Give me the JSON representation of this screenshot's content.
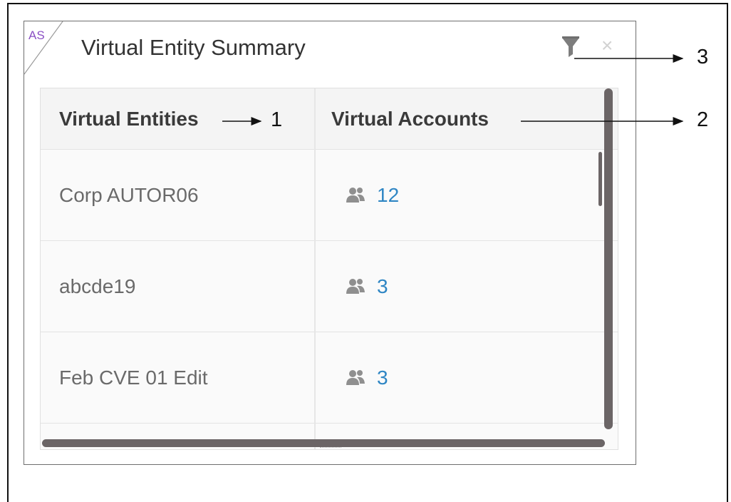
{
  "widget": {
    "badge": "AS",
    "title": "Virtual Entity Summary"
  },
  "table": {
    "headers": [
      "Virtual Entities",
      "Virtual Accounts"
    ],
    "rows": [
      {
        "entity": "Corp AUTOR06",
        "accounts": "12"
      },
      {
        "entity": "abcde19",
        "accounts": "3"
      },
      {
        "entity": "Feb CVE 01 Edit",
        "accounts": "3"
      }
    ]
  },
  "icons": {
    "filter": "filter-icon",
    "close": "close-icon",
    "accounts": "users-icon"
  },
  "callouts": [
    "1",
    "2",
    "3"
  ],
  "colors": {
    "badge": "#8a4fc4",
    "link": "#2f86c4",
    "scrollbar": "#6b6566"
  }
}
